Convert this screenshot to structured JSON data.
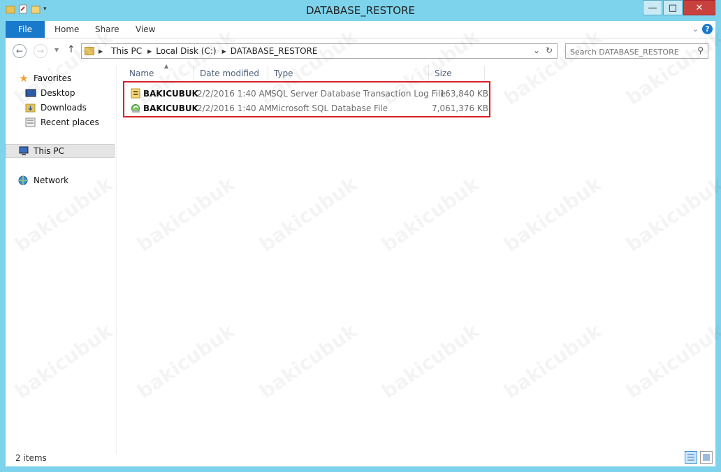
{
  "window": {
    "title": "DATABASE_RESTORE",
    "controls": {
      "minimize": "—",
      "maximize": "□",
      "close": "✕"
    }
  },
  "ribbon": {
    "tabs": [
      "File",
      "Home",
      "Share",
      "View"
    ],
    "help": "?"
  },
  "address": {
    "crumbs": [
      "This PC",
      "Local Disk (C:)",
      "DATABASE_RESTORE"
    ]
  },
  "search": {
    "placeholder": "Search DATABASE_RESTORE"
  },
  "nav_pane": {
    "items": [
      {
        "label": "Favorites",
        "icon": "star-icon"
      },
      {
        "label": "Desktop",
        "icon": "desktop-icon"
      },
      {
        "label": "Downloads",
        "icon": "downloads-icon"
      },
      {
        "label": "Recent places",
        "icon": "recent-icon"
      },
      {
        "label": "This PC",
        "icon": "computer-icon"
      },
      {
        "label": "Network",
        "icon": "network-icon"
      }
    ]
  },
  "columns": [
    "Name",
    "Date modified",
    "Type",
    "Size"
  ],
  "files": [
    {
      "name": "BAKICUBUK",
      "date": "2/2/2016 1:40 AM",
      "type": "SQL Server Database Transaction Log File",
      "size": "163,840 KB",
      "icon": "log-file-icon"
    },
    {
      "name": "BAKICUBUK",
      "date": "2/2/2016 1:40 AM",
      "type": "Microsoft SQL Database File",
      "size": "7,061,376 KB",
      "icon": "sql-db-file-icon"
    }
  ],
  "status": {
    "count": "2 items"
  },
  "watermark": "bakicubuk",
  "colors": {
    "frame": "#7ed3ec",
    "file_tab": "#1979ca",
    "highlight": "#d9202a"
  }
}
